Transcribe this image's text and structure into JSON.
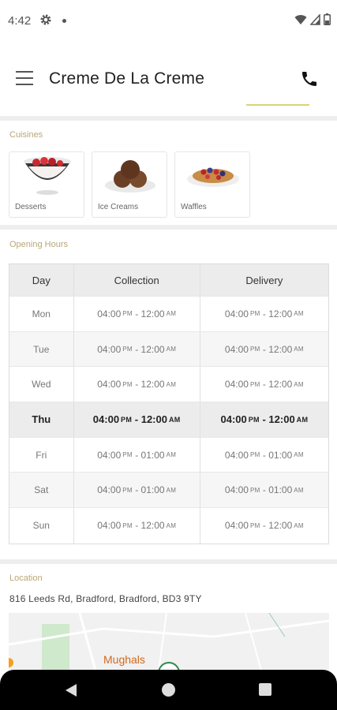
{
  "status_bar": {
    "time": "4:42"
  },
  "app": {
    "title": "Creme De La Creme"
  },
  "cuisines": {
    "label": "Cuisines",
    "items": [
      {
        "name": "Desserts",
        "icon": "dessert-bowl-icon"
      },
      {
        "name": "Ice Creams",
        "icon": "ice-cream-icon"
      },
      {
        "name": "Waffles",
        "icon": "waffle-icon"
      }
    ]
  },
  "opening_hours": {
    "label": "Opening Hours",
    "headers": [
      "Day",
      "Collection",
      "Delivery"
    ],
    "rows": [
      {
        "day": "Mon",
        "collection": {
          "open": "04:00",
          "open_ampm": "PM",
          "close": "12:00",
          "close_ampm": "AM"
        },
        "delivery": {
          "open": "04:00",
          "open_ampm": "PM",
          "close": "12:00",
          "close_ampm": "AM"
        }
      },
      {
        "day": "Tue",
        "collection": {
          "open": "04:00",
          "open_ampm": "PM",
          "close": "12:00",
          "close_ampm": "AM"
        },
        "delivery": {
          "open": "04:00",
          "open_ampm": "PM",
          "close": "12:00",
          "close_ampm": "AM"
        }
      },
      {
        "day": "Wed",
        "collection": {
          "open": "04:00",
          "open_ampm": "PM",
          "close": "12:00",
          "close_ampm": "AM"
        },
        "delivery": {
          "open": "04:00",
          "open_ampm": "PM",
          "close": "12:00",
          "close_ampm": "AM"
        }
      },
      {
        "day": "Thu",
        "collection": {
          "open": "04:00",
          "open_ampm": "PM",
          "close": "12:00",
          "close_ampm": "AM"
        },
        "delivery": {
          "open": "04:00",
          "open_ampm": "PM",
          "close": "12:00",
          "close_ampm": "AM"
        }
      },
      {
        "day": "Fri",
        "collection": {
          "open": "04:00",
          "open_ampm": "PM",
          "close": "01:00",
          "close_ampm": "AM"
        },
        "delivery": {
          "open": "04:00",
          "open_ampm": "PM",
          "close": "01:00",
          "close_ampm": "AM"
        }
      },
      {
        "day": "Sat",
        "collection": {
          "open": "04:00",
          "open_ampm": "PM",
          "close": "01:00",
          "close_ampm": "AM"
        },
        "delivery": {
          "open": "04:00",
          "open_ampm": "PM",
          "close": "01:00",
          "close_ampm": "AM"
        }
      },
      {
        "day": "Sun",
        "collection": {
          "open": "04:00",
          "open_ampm": "PM",
          "close": "12:00",
          "close_ampm": "AM"
        },
        "delivery": {
          "open": "04:00",
          "open_ampm": "PM",
          "close": "12:00",
          "close_ampm": "AM"
        }
      }
    ]
  },
  "location": {
    "label": "Location",
    "address": "816 Leeds Rd, Bradford, Bradford, BD3 9TY",
    "map_label": "Mughals"
  },
  "colors": {
    "accent": "#d9d27c",
    "section_label": "#b8a777"
  }
}
